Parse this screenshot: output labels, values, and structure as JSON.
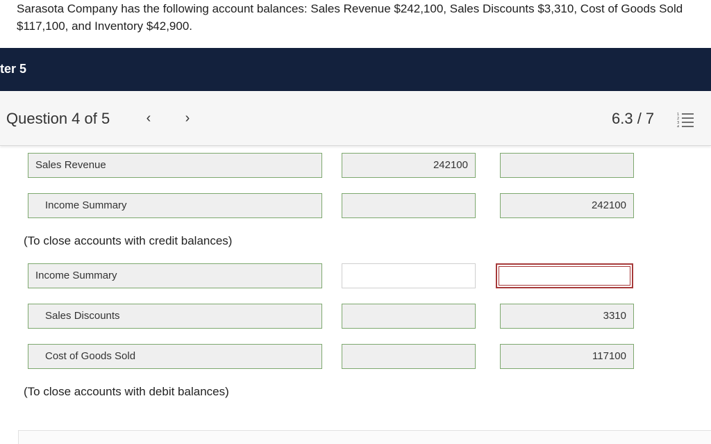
{
  "problem": {
    "text": "Sarasota Company has the following account balances: Sales Revenue $242,100, Sales Discounts $3,310, Cost of Goods Sold $117,100, and Inventory $42,900."
  },
  "chapter": {
    "label": "ter 5"
  },
  "question_bar": {
    "title": "Question 4 of 5",
    "prev_icon": "‹",
    "next_icon": "›",
    "score": "6.3 / 7"
  },
  "entries": [
    {
      "account": "Sales Revenue",
      "debit": "242100",
      "credit": ""
    },
    {
      "account": "Income Summary",
      "debit": "",
      "credit": "242100"
    },
    {
      "account": "Income Summary",
      "debit": "",
      "credit": ""
    },
    {
      "account": "Sales Discounts",
      "debit": "",
      "credit": "3310"
    },
    {
      "account": "Cost of Goods Sold",
      "debit": "",
      "credit": "117100"
    }
  ],
  "notes": {
    "credit": "(To close accounts with credit balances)",
    "debit": "(To close accounts with debit balances)"
  },
  "colors": {
    "header_bg": "#13213d",
    "field_border": "#7da86e",
    "error_border": "#a63a3a"
  }
}
